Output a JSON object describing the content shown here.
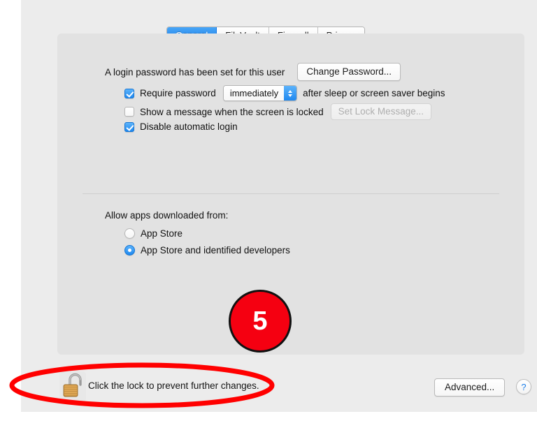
{
  "window": {
    "background_color": "#ececec",
    "panel_color": "#e2e2e2"
  },
  "tabs": [
    {
      "label": "General",
      "active": true
    },
    {
      "label": "FileVault",
      "active": false
    },
    {
      "label": "Firewall",
      "active": false
    },
    {
      "label": "Privacy",
      "active": false
    }
  ],
  "general": {
    "login_password_text": "A login password has been set for this user",
    "change_password_button": "Change Password...",
    "require_password": {
      "label": "Require password",
      "checked": true,
      "interval_value": "immediately",
      "suffix": "after sleep or screen saver begins"
    },
    "show_message": {
      "label": "Show a message when the screen is locked",
      "checked": false,
      "set_lock_message_button": "Set Lock Message...",
      "set_lock_message_disabled": true
    },
    "disable_auto_login": {
      "label": "Disable automatic login",
      "checked": true
    }
  },
  "allow_apps": {
    "heading": "Allow apps downloaded from:",
    "options": [
      {
        "label": "App Store",
        "selected": false
      },
      {
        "label": "App Store and identified developers",
        "selected": true
      }
    ]
  },
  "annotation": {
    "step_number": "5",
    "badge_color": "#f50011",
    "badge_text_color": "#ffffff",
    "ellipse_color": "#ff0000"
  },
  "footer": {
    "lock_icon": "open-padlock-icon",
    "lock_text": "Click the lock to prevent further changes.",
    "advanced_button": "Advanced...",
    "help_button": "?"
  }
}
